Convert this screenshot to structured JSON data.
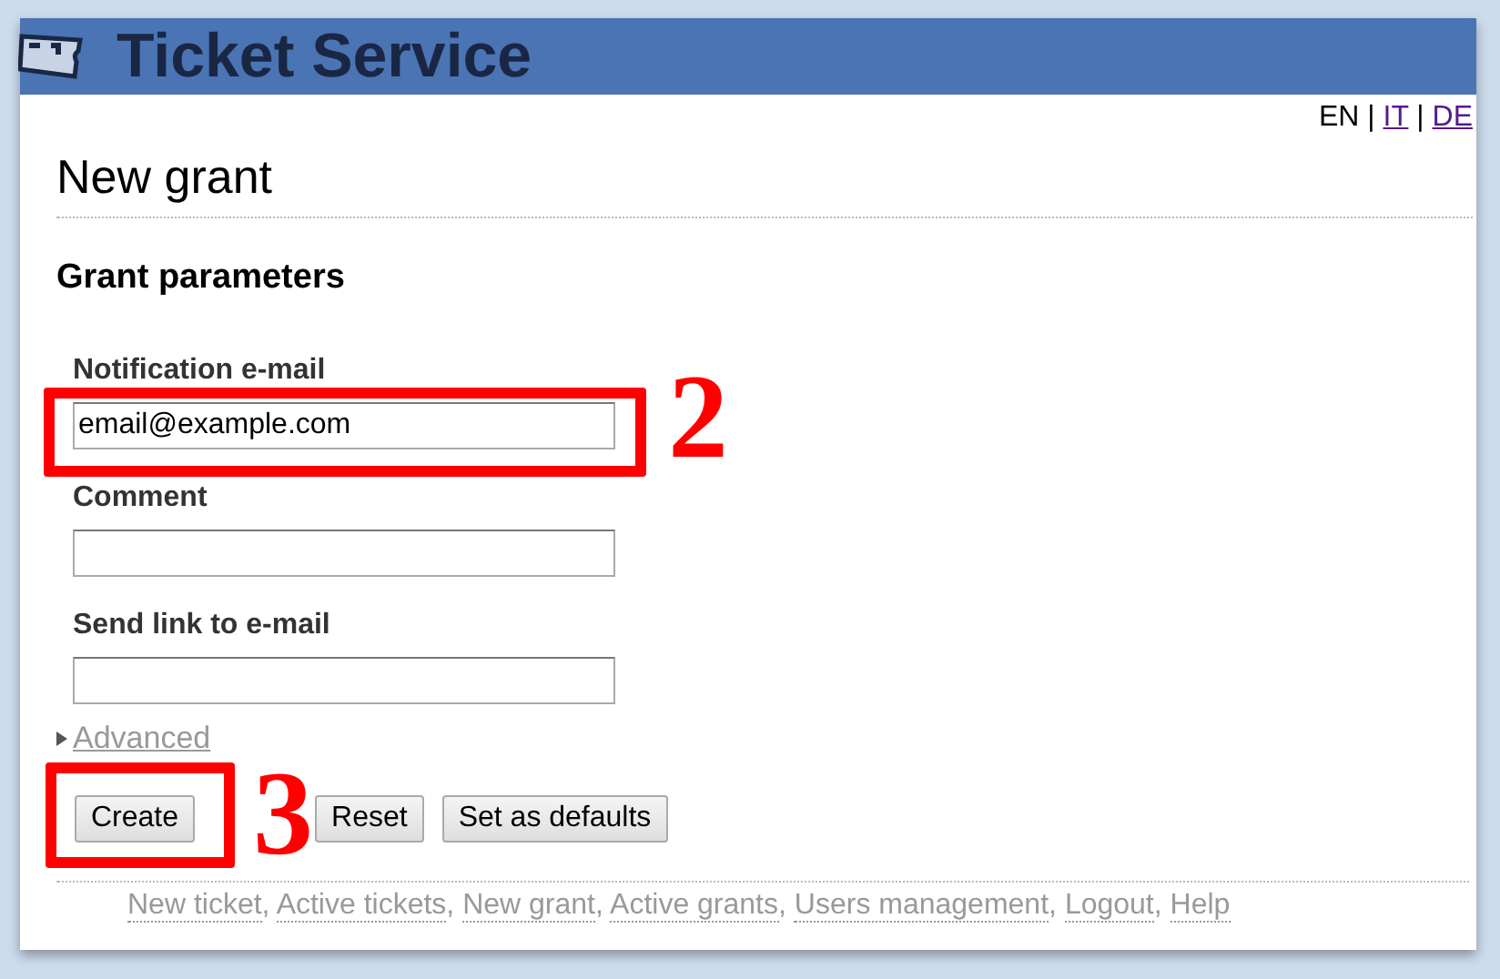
{
  "header": {
    "title": "Ticket Service"
  },
  "languages": [
    {
      "label": "EN",
      "selected": true
    },
    {
      "separator": "|",
      "label": "IT",
      "selected": false
    },
    {
      "separator": "|",
      "label": "DE",
      "selected": false
    }
  ],
  "page_title": "New grant",
  "section_title": "Grant parameters",
  "fields": [
    {
      "label": "Notification e-mail",
      "value": "email@example.com"
    },
    {
      "label": "Comment"
    },
    {
      "label": "Send link to e-mail"
    }
  ],
  "advanced": {
    "label": "Advanced",
    "expanded": false
  },
  "buttons": [
    "Create",
    "Reset",
    "Set as defaults"
  ],
  "footer_links": [
    {
      "label": "New ticket",
      "separator": ","
    },
    {
      "label": "Active tickets",
      "separator": ","
    },
    {
      "label": "New grant",
      "separator": ","
    },
    {
      "label": "Active grants",
      "separator": ","
    },
    {
      "label": "Users management",
      "separator": ","
    },
    {
      "label": "Logout",
      "separator": ","
    },
    {
      "label": "Help"
    }
  ],
  "annotations": [
    {
      "number": "2"
    },
    {
      "number": "3"
    }
  ]
}
